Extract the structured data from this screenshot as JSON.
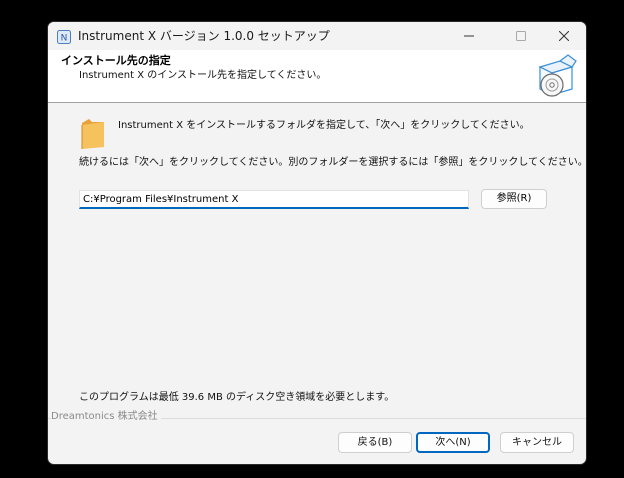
{
  "window": {
    "title": "Instrument X バージョン 1.0.0 セットアップ",
    "controls": [
      "minimize",
      "maximize",
      "close"
    ]
  },
  "header": {
    "title": "インストール先の指定",
    "subtitle": "Instrument X のインストール先を指定してください。",
    "icon": "setup-box-disc-icon"
  },
  "main": {
    "description": "Instrument X をインストールするフォルダを指定して、「次へ」をクリックしてください。",
    "instruction": "続けるには「次へ」をクリックしてください。別のフォルダーを選択するには「参照」をクリックしてください。",
    "install_path": "C:¥Program Files¥Instrument X",
    "browse_label": "参照(R)",
    "disk_space": "このプログラムは最低 39.6 MB のディスク空き領域を必要とします。"
  },
  "footer": {
    "brand": "Dreamtonics 株式会社",
    "back_label": "戻る(B)",
    "next_label": "次へ(N)",
    "cancel_label": "キャンセル"
  },
  "colors": {
    "accent": "#0067c0",
    "folder": "#f0b54a",
    "window_bg": "#f3f3f3",
    "header_bg": "#ffffff"
  }
}
